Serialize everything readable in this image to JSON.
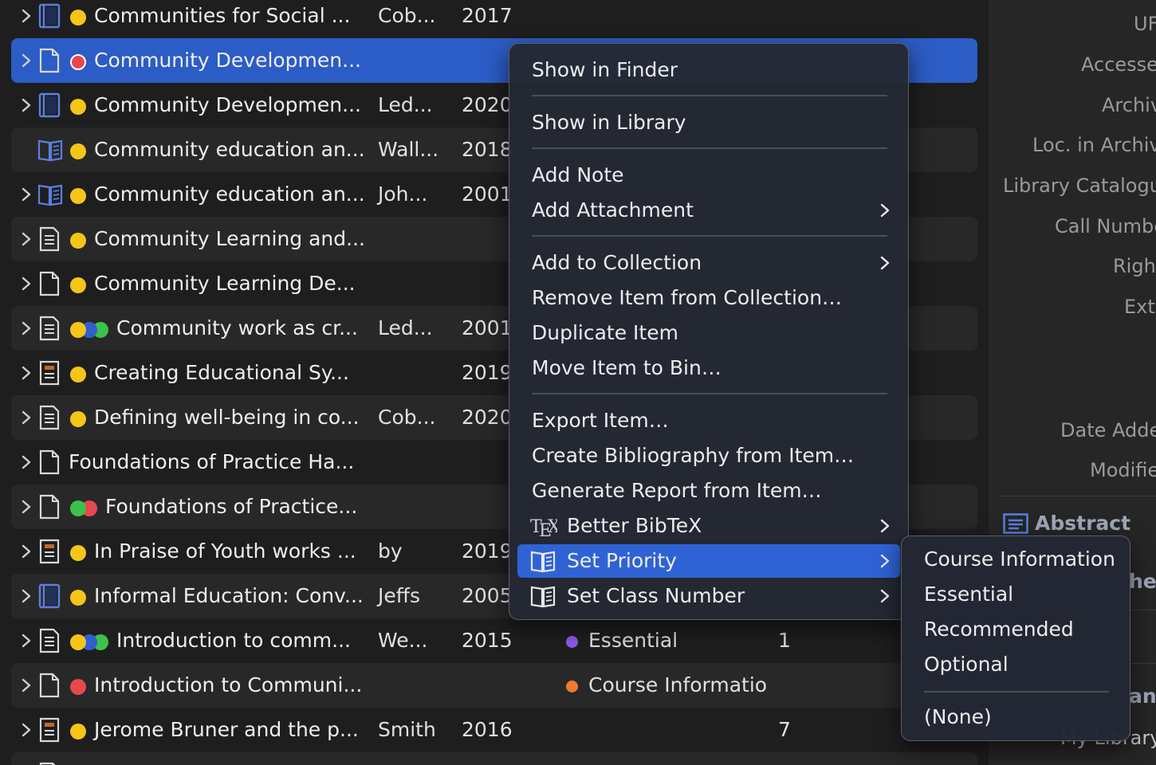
{
  "items": [
    {
      "title": "Communities for Social ...",
      "creator": "Cob...",
      "year": "2017",
      "icon": "book-icon",
      "dots": [
        "#f5c518"
      ]
    },
    {
      "title": "Community Developmen...",
      "creator": "",
      "year": "",
      "icon": "document-icon",
      "dots": [
        "#e5484d"
      ],
      "selected": true
    },
    {
      "title": "Community Developmen...",
      "creator": "Led...",
      "year": "2020",
      "icon": "book-icon",
      "dots": [
        "#f5c518"
      ]
    },
    {
      "title": "Community education an...",
      "creator": "Wall...",
      "year": "2018",
      "icon": "book-section-icon",
      "dots": [
        "#f5c518"
      ],
      "noChevron": true
    },
    {
      "title": "Community education an...",
      "creator": "Joh...",
      "year": "2001",
      "icon": "book-section-icon",
      "dots": [
        "#f5c518"
      ]
    },
    {
      "title": "Community Learning and...",
      "creator": "",
      "year": "",
      "icon": "journal-article-icon",
      "dots": [
        "#f5c518"
      ]
    },
    {
      "title": "Community Learning De...",
      "creator": "",
      "year": "",
      "icon": "document-icon",
      "dots": [
        "#f5c518"
      ]
    },
    {
      "title": "Community work as cr...",
      "creator": "Led...",
      "year": "2001",
      "icon": "journal-article-icon",
      "dots": [
        "#f5c518",
        "#2f5fd0",
        "#3cc24b"
      ]
    },
    {
      "title": "Creating Educational Sy...",
      "creator": "",
      "year": "2019",
      "icon": "report-icon",
      "dots": [
        "#f5c518"
      ]
    },
    {
      "title": "Defining well-being in co...",
      "creator": "Cob...",
      "year": "2020",
      "icon": "journal-article-icon",
      "dots": [
        "#f5c518"
      ]
    },
    {
      "title": "Foundations of Practice Ha...",
      "creator": "",
      "year": "",
      "icon": "document-icon",
      "dots": []
    },
    {
      "title": "Foundations of Practice...",
      "creator": "",
      "year": "",
      "icon": "document-icon",
      "dots": [
        "#3cc24b",
        "#e5484d"
      ]
    },
    {
      "title": "In Praise of Youth works ...",
      "creator": "by",
      "year": "2019",
      "icon": "report-icon",
      "dots": [
        "#f5c518"
      ]
    },
    {
      "title": "Informal Education: Conv...",
      "creator": "Jeffs",
      "year": "2005",
      "icon": "book-icon",
      "dots": [
        "#f5c518"
      ]
    },
    {
      "title": "Introduction to comm...",
      "creator": "We...",
      "year": "2015",
      "icon": "journal-article-icon",
      "dots": [
        "#f5c518",
        "#2f5fd0",
        "#3cc24b"
      ],
      "priority": "Essential",
      "priorityColor": "#8e5cf0",
      "classNumber": "1"
    },
    {
      "title": "Introduction to Communi...",
      "creator": "",
      "year": "",
      "icon": "document-icon",
      "dots": [
        "#e5484d"
      ],
      "priority": "Course Informatio",
      "priorityColor": "#f07a2b"
    },
    {
      "title": "Jerome Bruner and the p...",
      "creator": "Smith",
      "year": "2016",
      "icon": "report-icon",
      "dots": [
        "#f5c518"
      ],
      "classNumber": "7"
    },
    {
      "title": "",
      "creator": "",
      "year": "",
      "icon": "document-icon",
      "dots": []
    }
  ],
  "pane": {
    "fields": [
      "UF",
      "Accesse",
      "Archiv",
      "Loc. in Archiv",
      "Library Catalogu",
      "Call Numbe",
      "Righ",
      "Ext",
      "Date Adde",
      "Modifie"
    ],
    "abstract_header": "Abstract",
    "partial_labels": [
      "her",
      "anc",
      "My Library"
    ]
  },
  "context_menu": {
    "items": [
      {
        "label": "Show in Finder"
      },
      {
        "label": "Show in Library"
      },
      {
        "label": "Add Note"
      },
      {
        "label": "Add Attachment",
        "submenu": true
      },
      {
        "label": "Add to Collection",
        "submenu": true
      },
      {
        "label": "Remove Item from Collection…"
      },
      {
        "label": "Duplicate Item"
      },
      {
        "label": "Move Item to Bin…"
      },
      {
        "label": "Export Item…"
      },
      {
        "label": "Create Bibliography from Item…"
      },
      {
        "label": "Generate Report from Item…"
      },
      {
        "label": "Better BibTeX",
        "submenu": true,
        "icon": "tex-icon"
      },
      {
        "label": "Set Priority",
        "submenu": true,
        "icon": "book-open-icon",
        "highlighted": true
      },
      {
        "label": "Set Class Number",
        "submenu": true,
        "icon": "book-open-icon"
      }
    ]
  },
  "priority_submenu": {
    "options": [
      "Course Information",
      "Essential",
      "Recommended",
      "Optional",
      "(None)"
    ]
  },
  "colors": {
    "selection": "#2c5cc5",
    "menu_highlight": "#2f63d5",
    "icon_blue": "#5b7fe0"
  }
}
